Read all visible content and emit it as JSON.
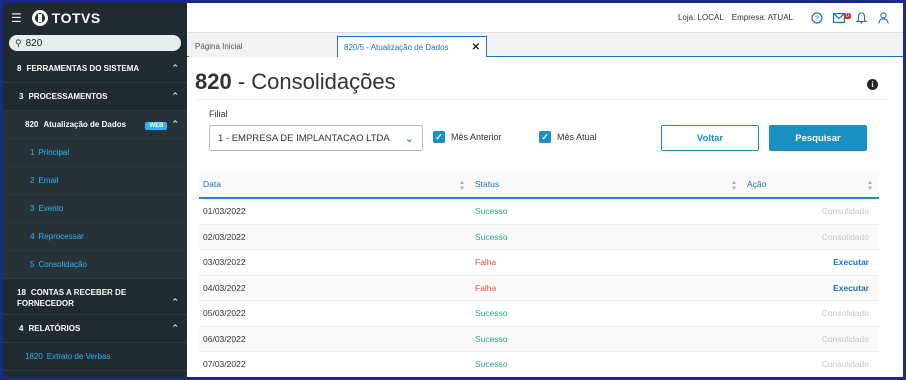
{
  "brand": {
    "name": "TOTVS"
  },
  "search": {
    "value": "820"
  },
  "sidebar": {
    "items": [
      {
        "num": "8",
        "label": "FERRAMENTAS DO SISTEMA"
      },
      {
        "num": "3",
        "label": "PROCESSAMENTOS"
      },
      {
        "num": "820",
        "label": "Atualização de Dados",
        "badge": "WEB"
      },
      {
        "num": "1",
        "label": "Principal"
      },
      {
        "num": "2",
        "label": "Email"
      },
      {
        "num": "3",
        "label": "Evento"
      },
      {
        "num": "4",
        "label": "Reprocessar"
      },
      {
        "num": "5",
        "label": "Consolidação"
      },
      {
        "num": "18",
        "label": "CONTAS A RECEBER DE FORNECEDOR"
      },
      {
        "num": "4",
        "label": "RELATÓRIOS"
      },
      {
        "num": "1820",
        "label": "Extrato de Verbas"
      }
    ]
  },
  "topbar": {
    "loja": "Loja: LOCAL",
    "empresa": "Empresa: ATUAL",
    "mail_count": "0"
  },
  "tabs": [
    {
      "label": "Página Inicial"
    },
    {
      "label": "820/5 - Atualização de Dados"
    }
  ],
  "page": {
    "code": "820",
    "title": " - Consolidações"
  },
  "form": {
    "filial_label": "Filial",
    "filial_value": "1 - EMPRESA DE IMPLANTACAO LTDA",
    "mes_anterior": "Mês Anterior",
    "mes_atual": "Mês Atual",
    "voltar": "Voltar",
    "pesquisar": "Pesquisar"
  },
  "table": {
    "headers": {
      "data": "Data",
      "status": "Status",
      "acao": "Ação"
    },
    "rows": [
      {
        "data": "01/03/2022",
        "status": "Sucesso",
        "acao": "Consolidado"
      },
      {
        "data": "02/03/2022",
        "status": "Sucesso",
        "acao": "Consolidado"
      },
      {
        "data": "03/03/2022",
        "status": "Falha",
        "acao": "Executar"
      },
      {
        "data": "04/03/2022",
        "status": "Falha",
        "acao": "Executar"
      },
      {
        "data": "05/03/2022",
        "status": "Sucesso",
        "acao": "Consolidado"
      },
      {
        "data": "06/03/2022",
        "status": "Sucesso",
        "acao": "Consolidado"
      },
      {
        "data": "07/03/2022",
        "status": "Sucesso",
        "acao": "Consolidado"
      }
    ]
  },
  "colors": {
    "accent": "#1a8fc2",
    "success": "#2aa88a",
    "fail": "#d9534f",
    "sidebar": "#1f2a31",
    "link": "#29b6f6"
  }
}
